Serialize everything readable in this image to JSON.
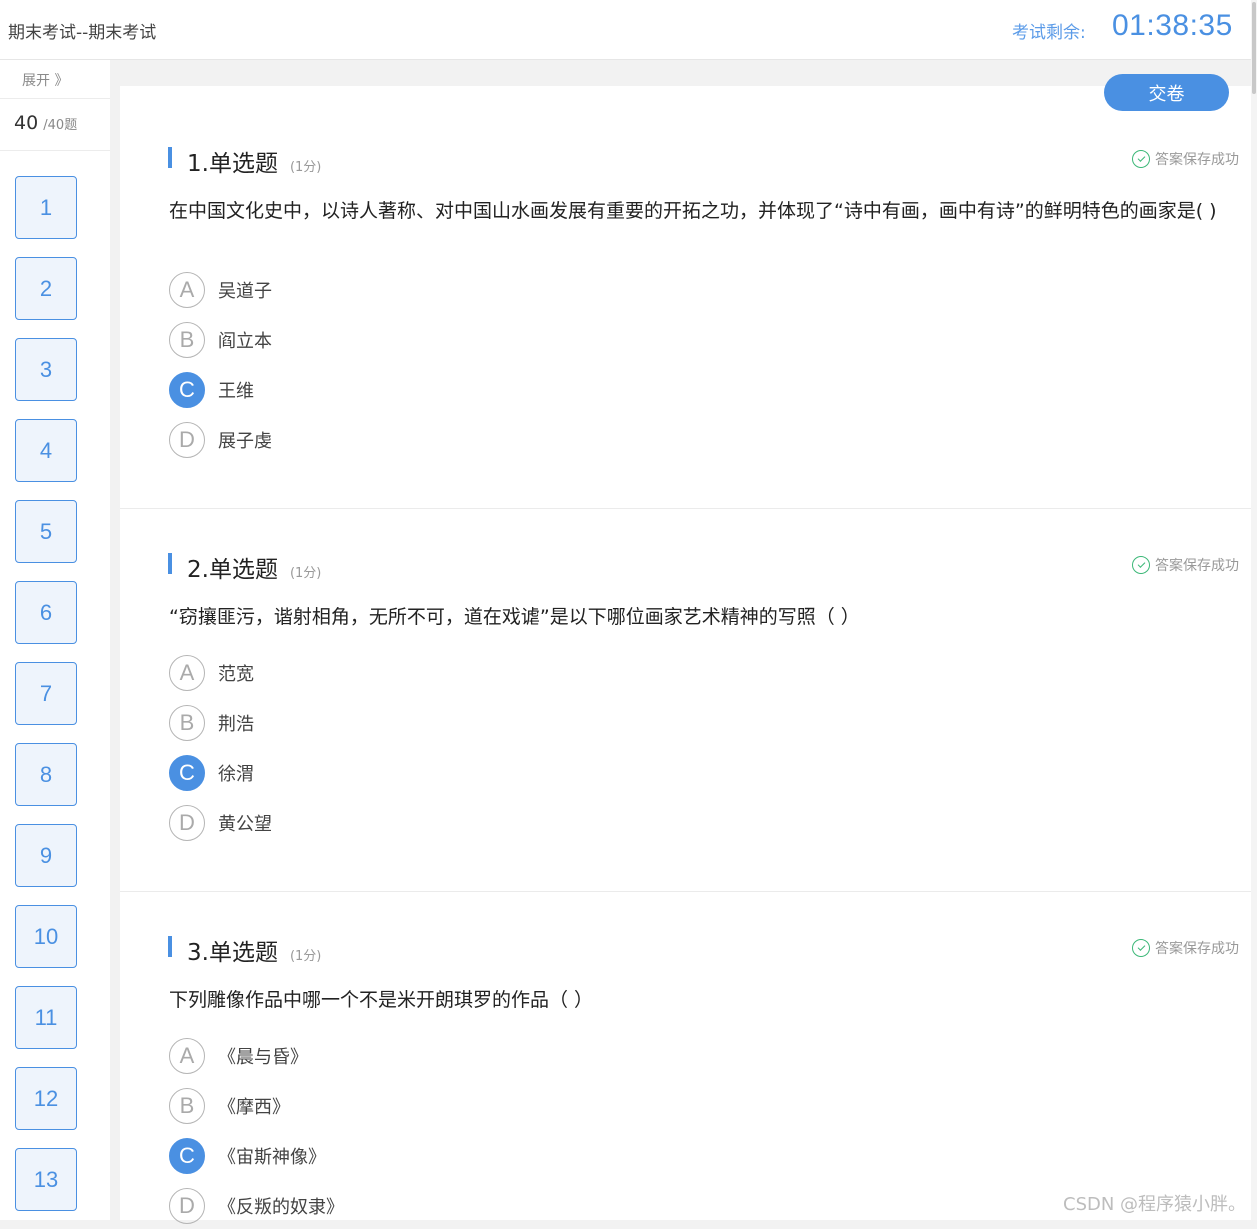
{
  "header": {
    "title": "期末考试--期末考试",
    "timer_label": "考试剩余:",
    "timer": "01:38:35"
  },
  "sidebar": {
    "expand_label": "展开 》",
    "progress_current": "40",
    "progress_total": "/40题",
    "question_numbers": [
      "1",
      "2",
      "3",
      "4",
      "5",
      "6",
      "7",
      "8",
      "9",
      "10",
      "11",
      "12",
      "13"
    ]
  },
  "submit_label": "交卷",
  "questions": [
    {
      "type": "1.单选题",
      "score": "(1分)",
      "status": "答案保存成功",
      "stem": "在中国文化史中，以诗人著称、对中国山水画发展有重要的开拓之功，并体现了“诗中有画，画中有诗”的鲜明特色的画家是( )",
      "options": [
        {
          "letter": "A",
          "text": "吴道子"
        },
        {
          "letter": "B",
          "text": "阎立本"
        },
        {
          "letter": "C",
          "text": "王维"
        },
        {
          "letter": "D",
          "text": "展子虔"
        }
      ],
      "selected": "C"
    },
    {
      "type": "2.单选题",
      "score": "(1分)",
      "status": "答案保存成功",
      "stem": "“窃攘匪污，谐射相角，无所不可，道在戏谑”是以下哪位画家艺术精神的写照（ ）",
      "options": [
        {
          "letter": "A",
          "text": "范宽"
        },
        {
          "letter": "B",
          "text": "荆浩"
        },
        {
          "letter": "C",
          "text": "徐渭"
        },
        {
          "letter": "D",
          "text": "黄公望"
        }
      ],
      "selected": "C"
    },
    {
      "type": "3.单选题",
      "score": "(1分)",
      "status": "答案保存成功",
      "stem": "下列雕像作品中哪一个不是米开朗琪罗的作品（ ）",
      "options": [
        {
          "letter": "A",
          "text": "《晨与昏》"
        },
        {
          "letter": "B",
          "text": "《摩西》"
        },
        {
          "letter": "C",
          "text": "《宙斯神像》"
        },
        {
          "letter": "D",
          "text": "《反叛的奴隶》"
        }
      ],
      "selected": "C"
    }
  ],
  "watermark": "CSDN @程序猿小胖。",
  "colors": {
    "accent": "#4a90e2",
    "saved_green": "#3cb878"
  }
}
